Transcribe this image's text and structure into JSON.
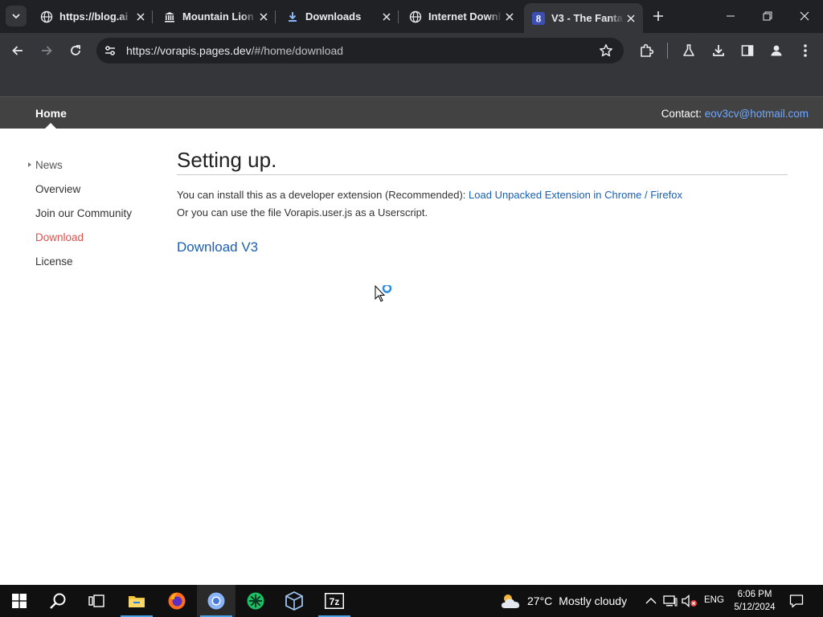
{
  "browser": {
    "tabs": [
      {
        "title": "https://blog.ai",
        "favicon": "globe-icon",
        "active": false
      },
      {
        "title": "Mountain Lion",
        "favicon": "institution-icon",
        "active": false
      },
      {
        "title": "Downloads",
        "favicon": "download-icon",
        "active": false
      },
      {
        "title": "Internet Downl",
        "favicon": "globe-icon",
        "active": false
      },
      {
        "title": "V3 - The Fanta",
        "favicon": "v3-icon",
        "active": true
      }
    ],
    "url_host": "https://vorapis.pages.dev",
    "url_path": "/#/home/download",
    "accent": "#8ab4f8"
  },
  "site": {
    "nav_home": "Home",
    "contact_label": "Contact:",
    "contact_email": "eov3cv@hotmail.com",
    "sidebar": [
      {
        "label": "News"
      },
      {
        "label": "Overview"
      },
      {
        "label": "Join our Community"
      },
      {
        "label": "Download"
      },
      {
        "label": "License"
      }
    ],
    "heading": "Setting up.",
    "line1_text": "You can install this as a developer extension (Recommended):",
    "line1_link": "Load Unpacked Extension in Chrome / Firefox",
    "line2_text": "Or you can use the file Vorapis.user.js as a Userscript.",
    "download_link": "Download V3",
    "active_color": "#d9534f",
    "link_color": "#1a5fb4"
  },
  "taskbar": {
    "weather_temp": "27°C",
    "weather_desc": "Mostly cloudy",
    "language": "ENG",
    "time": "6:06 PM",
    "date": "5/12/2024"
  }
}
